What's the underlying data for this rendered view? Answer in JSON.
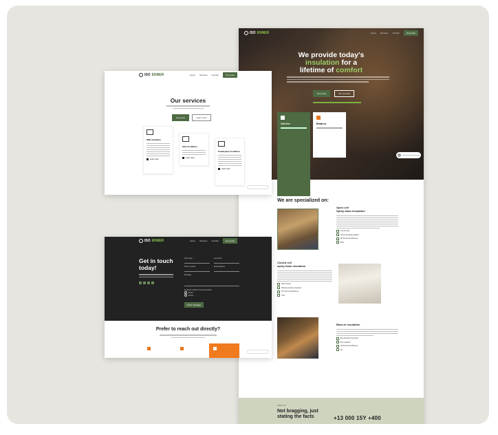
{
  "main_page": {
    "nav": {
      "logo_a": "ISO",
      "logo_b": "ENNER",
      "links": [
        "Home",
        "Services",
        "Contact"
      ],
      "cta": "Get quote"
    },
    "hero": {
      "title_prefix": "We provide today's",
      "title_highlight1": "insulation",
      "title_mid": "for a",
      "title_line3a": "lifetime of",
      "title_highlight2": "comfort",
      "btn_primary": "Get quote",
      "btn_secondary": "Our services"
    },
    "cards": [
      {
        "title": "Make a quote yourself"
      },
      {
        "title": "Email us"
      },
      {
        "title": "Call free"
      }
    ],
    "specialized": {
      "eyebrow": "OUR PRODUCTS",
      "title": "We are specialized on:"
    },
    "services": [
      {
        "title1": "Open cell",
        "title2": "Spray foam insulation",
        "checks": [
          "Low density",
          "Sound proofing qualities",
          "R3.5 thermal efficiency",
          "50%"
        ]
      },
      {
        "title1": "Closed cell",
        "title2": "spray foam insulation",
        "checks": [
          "High density",
          "Moisture barrier properties",
          "R7.0 thermal efficiency",
          "70%"
        ]
      },
      {
        "title1": "Blow-in insulation",
        "title2": "",
        "checks": [
          "Eco-friendly & recycled",
          "Fire-resistant",
          "R3.5 thermal efficiency",
          "60"
        ]
      }
    ],
    "brag": {
      "eyebrow": "ABOUT US",
      "title_line1": "Not bragging, just",
      "title_line2": "stating the facts",
      "stats": "+13 000  15Y  +400"
    }
  },
  "services_page": {
    "nav": {
      "logo_a": "ISO",
      "logo_b": "ENNER",
      "links": [
        "Home",
        "Services",
        "Contact"
      ],
      "cta": "Get quote"
    },
    "title": "Our services",
    "btn_primary": "Get quote",
    "btn_secondary": "Learn more",
    "cards": [
      {
        "title": "Wall insulation",
        "more": "Learn more"
      },
      {
        "title": "Attic insulation",
        "more": "Learn more"
      },
      {
        "title": "Crawlspace insulation",
        "more": "Learn more"
      }
    ]
  },
  "contact_page": {
    "nav": {
      "logo_a": "ISO",
      "logo_b": "ENNER",
      "links": [
        "Home",
        "Services",
        "Contact"
      ],
      "cta": "Get quote"
    },
    "title_line1": "Get in touch",
    "title_line2": "today!",
    "form": {
      "first_name": "First name",
      "last_name": "Last name",
      "phone": "Phone number",
      "email": "Email address",
      "message": "Message",
      "contact_pref": "Preferred method of communication",
      "radio1": "Email",
      "radio2": "Phone",
      "submit": "Send message"
    },
    "prefer_title": "Prefer to reach out directly?"
  }
}
